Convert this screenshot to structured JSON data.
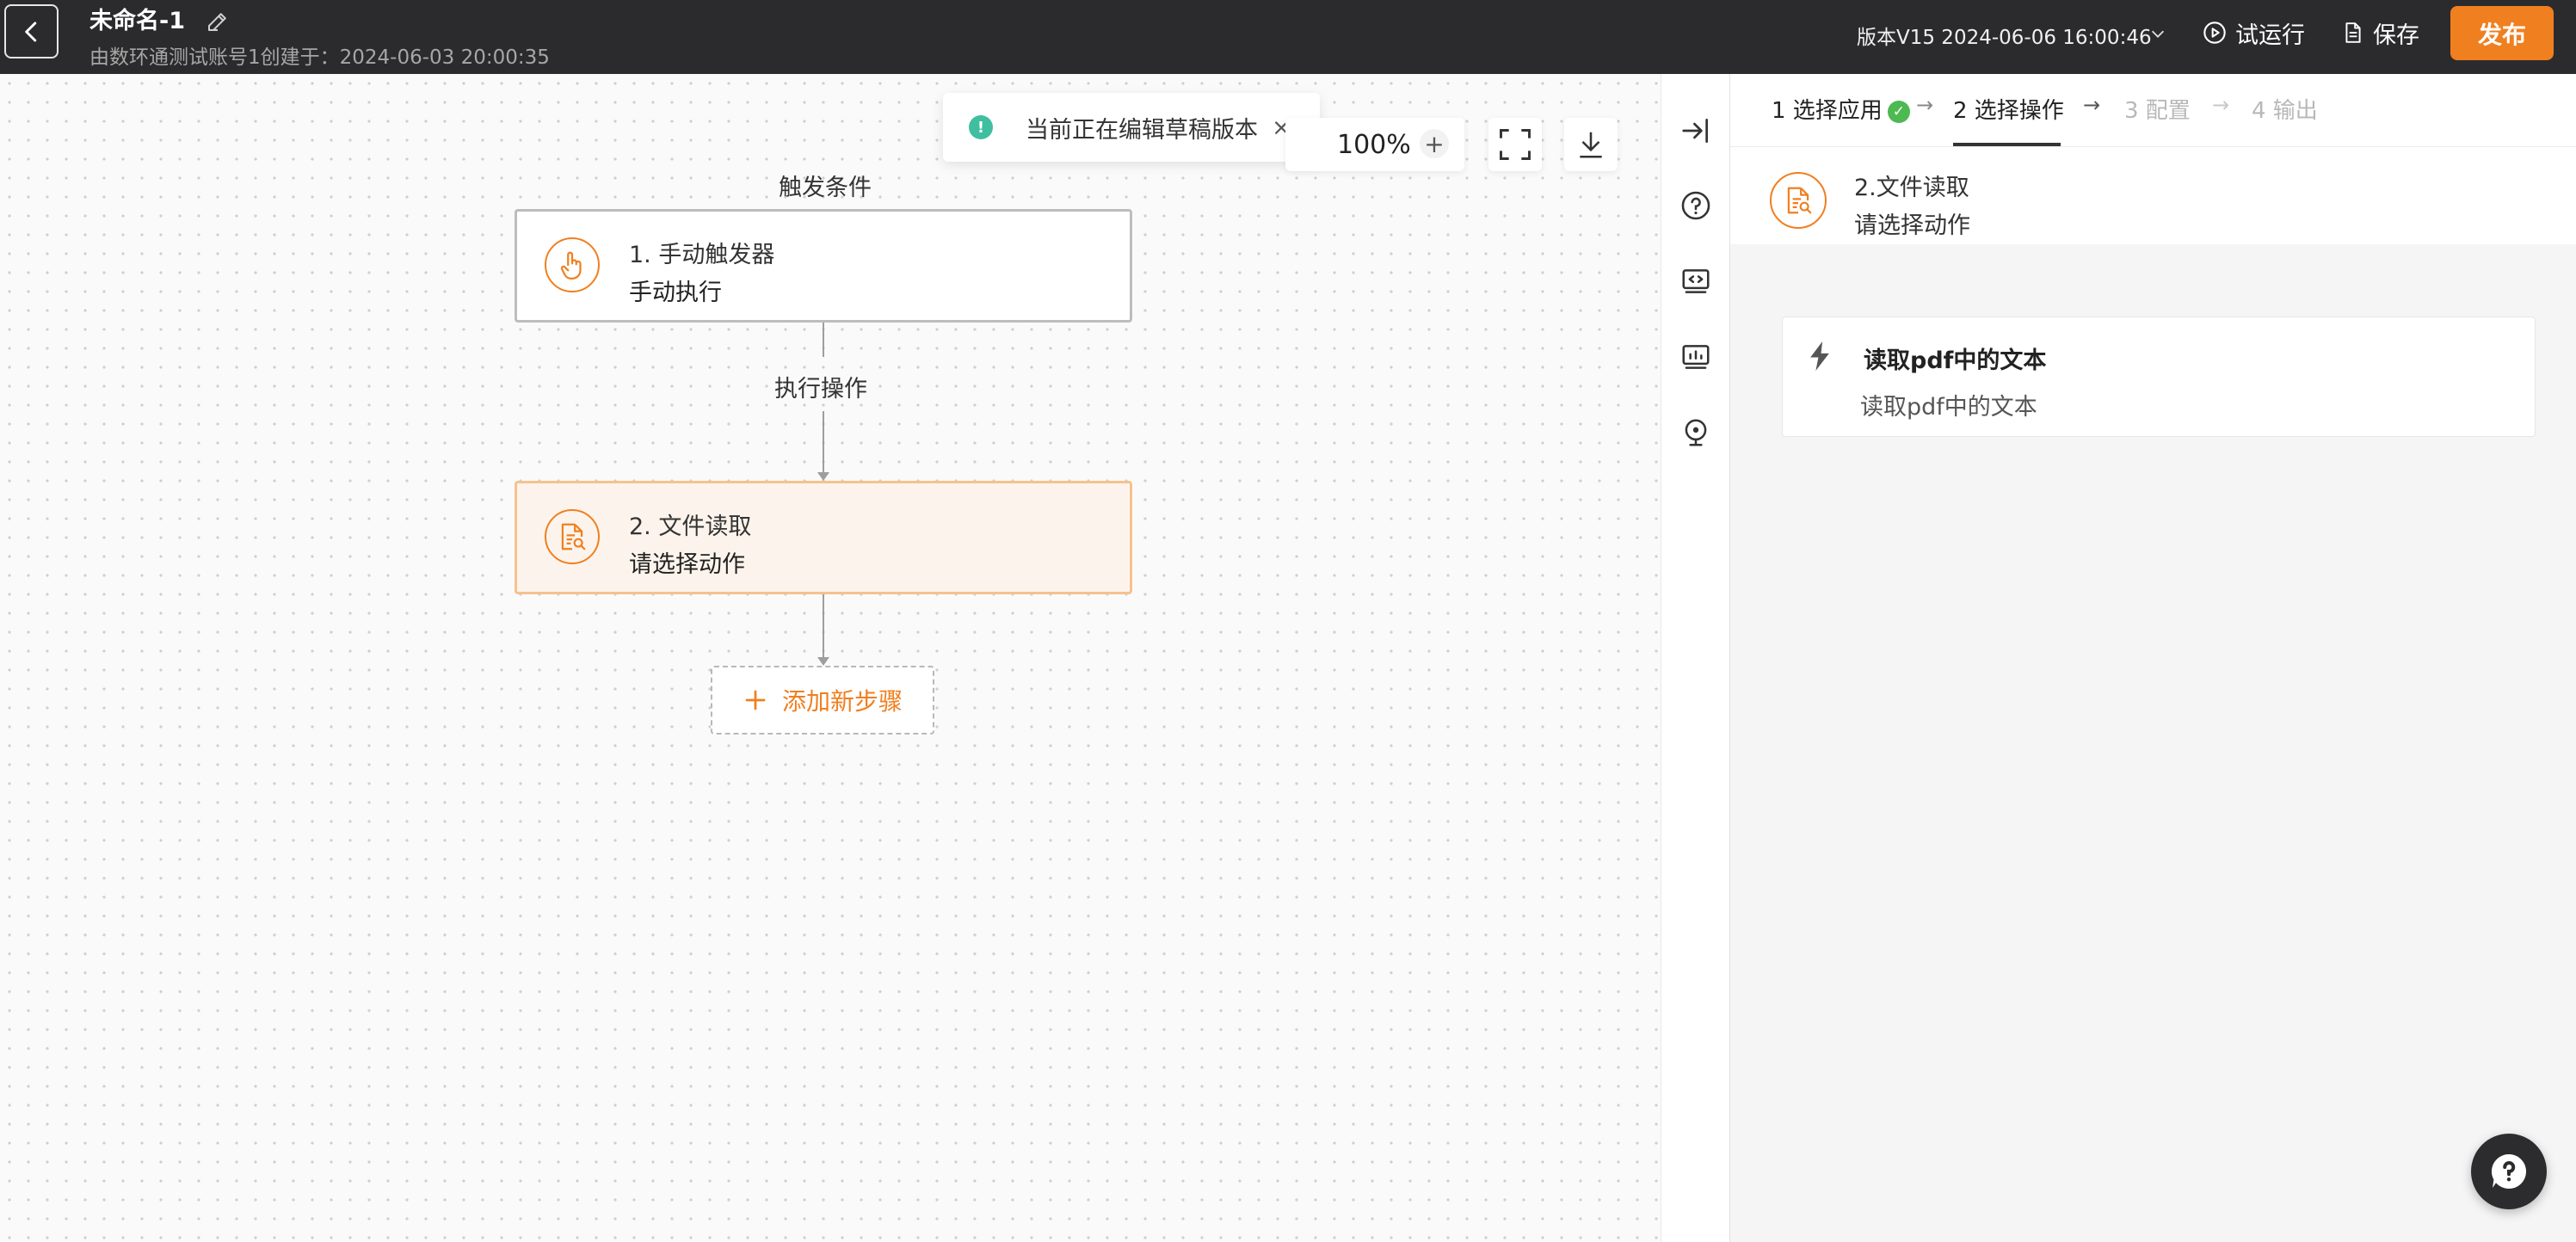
{
  "header": {
    "back_label": "",
    "title": "未命名-1",
    "subtitle": "由数环通测试账号1创建于：2024-06-03 20:00:35",
    "version": "版本V15 2024-06-06 16:00:46",
    "run_label": "试运行",
    "save_label": "保存",
    "publish_label": "发布"
  },
  "canvas": {
    "toast_text": "当前正在编辑草稿版本",
    "toast_icon": "!",
    "zoom_level": "100%",
    "zoom_plus": "+",
    "trigger_label": "触发条件",
    "exec_label": "执行操作",
    "nodes": [
      {
        "title": "1. 手动触发器",
        "subtitle": "手动执行",
        "icon": "hand-pointer-icon"
      },
      {
        "title": "2. 文件读取",
        "subtitle": "请选择动作",
        "icon": "file-search-icon"
      }
    ],
    "add_step_label": "添加新步骤"
  },
  "panel": {
    "steps": [
      {
        "label": "1 选择应用",
        "state": "done"
      },
      {
        "label": "2 选择操作",
        "state": "active"
      },
      {
        "label": "3 配置",
        "state": "pending"
      },
      {
        "label": "4 输出",
        "state": "pending"
      }
    ],
    "selected": {
      "title": "2.文件读取",
      "subtitle": "请选择动作"
    },
    "action": {
      "title": "读取pdf中的文本",
      "description": "读取pdf中的文本"
    }
  },
  "colors": {
    "accent": "#f07f1f",
    "header_bg": "#2b2b2d",
    "success": "#4cba50",
    "toast_info": "#3fbf9f"
  }
}
